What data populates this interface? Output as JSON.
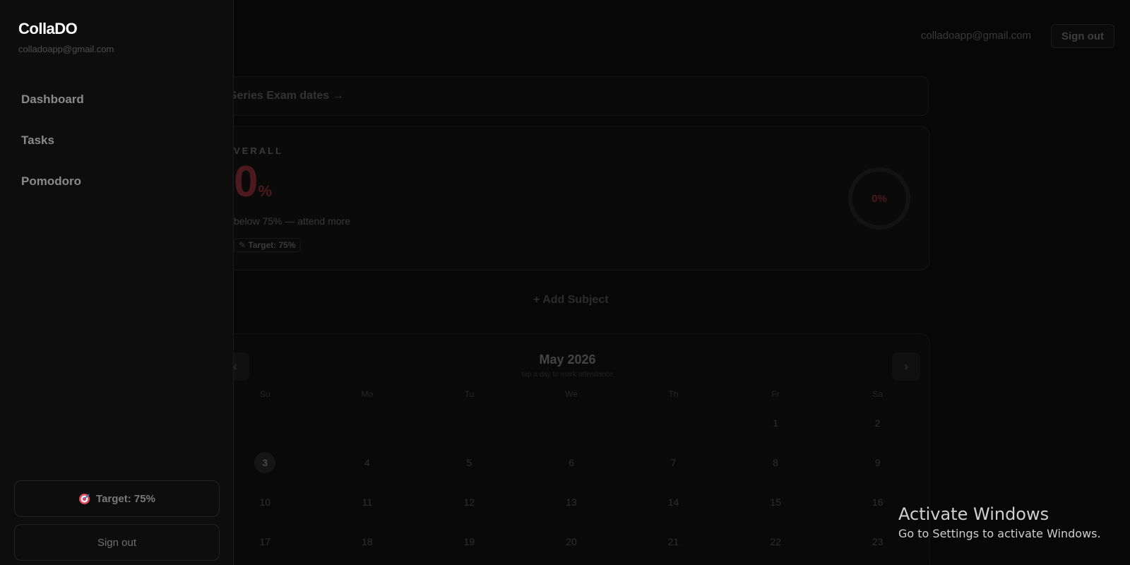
{
  "topbar": {
    "email": "colladoapp@gmail.com",
    "signout_label": "Sign out"
  },
  "banner": {
    "text": "t Series Exam dates →"
  },
  "overall": {
    "label": "VERALL",
    "value": "0",
    "value_unit": "%",
    "warning": "below 75% — attend more",
    "target": "✎ Target: 75%",
    "ring_text": "0%"
  },
  "add_subject_label": "+ Add Subject",
  "calendar": {
    "prev_label": "‹",
    "next_label": "›",
    "title": "May 2026",
    "subtitle": "tap a day to mark attendance",
    "weekdays": [
      "Su",
      "Mo",
      "Tu",
      "We",
      "Th",
      "Fr",
      "Sa"
    ],
    "days": [
      "",
      "",
      "",
      "",
      "",
      "1",
      "2",
      "3",
      "4",
      "5",
      "6",
      "7",
      "8",
      "9",
      "10",
      "11",
      "12",
      "13",
      "14",
      "15",
      "16",
      "17",
      "18",
      "19",
      "20",
      "21",
      "22",
      "23"
    ],
    "today": "3"
  },
  "sidebar": {
    "brand": "CollaDO",
    "email": "colladoapp@gmail.com",
    "nav": [
      {
        "label": "Dashboard"
      },
      {
        "label": "Tasks"
      },
      {
        "label": "Pomodoro"
      }
    ],
    "target_label": "Target: 75%",
    "target_icon": "target-icon",
    "signout_label": "Sign out"
  },
  "watermark": {
    "title": "Activate Windows",
    "subtitle": "Go to Settings to activate Windows."
  },
  "colors": {
    "accent_red": "#c0392b",
    "sidebar_bg": "#0d0d0d"
  }
}
